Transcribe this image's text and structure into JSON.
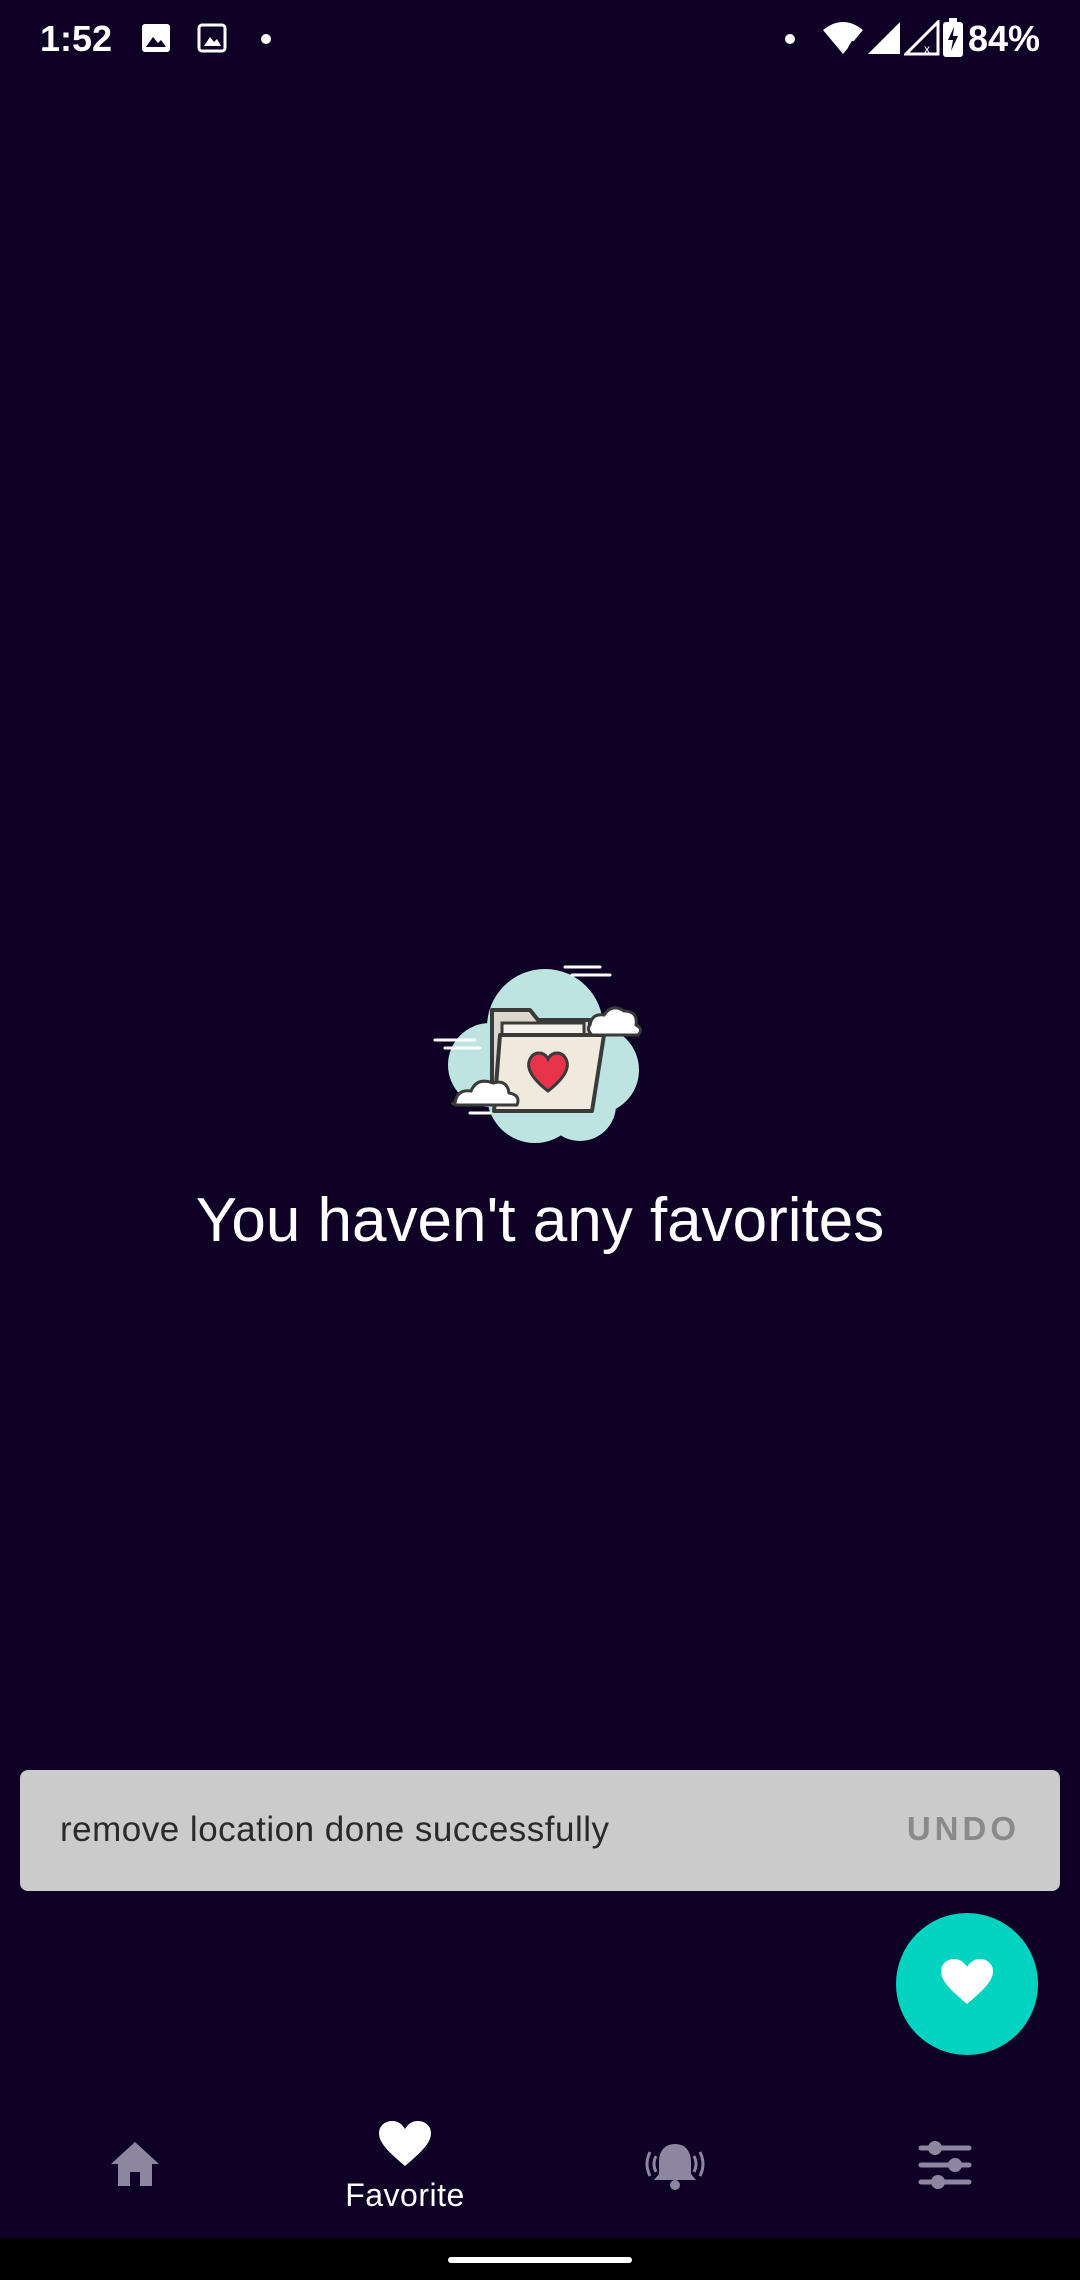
{
  "status_bar": {
    "time": "1:52",
    "battery": "84%",
    "icons": [
      "image-icon",
      "image-icon",
      "dot-icon",
      "dot-icon",
      "wifi-icon",
      "signal-icon",
      "signal-no-data-icon",
      "battery-charging-icon"
    ]
  },
  "empty_state": {
    "illustration": "favorite-folder-cloud-illustration",
    "message": "You haven't any favorites"
  },
  "snackbar": {
    "message": "remove location done successfully",
    "action": "UNDO"
  },
  "fab": {
    "icon": "heart-icon",
    "color": "#00d4c0"
  },
  "bottom_nav": {
    "items": [
      {
        "icon": "home-icon",
        "label": "",
        "active": false
      },
      {
        "icon": "heart-icon",
        "label": "Favorite",
        "active": true
      },
      {
        "icon": "alarm-bell-icon",
        "label": "",
        "active": false
      },
      {
        "icon": "settings-sliders-icon",
        "label": "",
        "active": false
      }
    ]
  },
  "colors": {
    "background": "#0f0126",
    "accent": "#00d4c0",
    "snackbar": "#cbcbcb",
    "inactive_icon": "#8d86a0"
  }
}
